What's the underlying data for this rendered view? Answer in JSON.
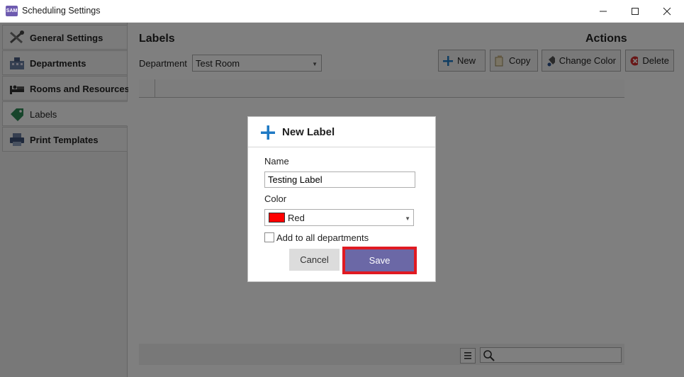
{
  "window": {
    "title": "Scheduling Settings",
    "app_icon_text": "SAM"
  },
  "sidebar": {
    "items": [
      {
        "label": "General Settings",
        "icon": "tools-icon"
      },
      {
        "label": "Departments",
        "icon": "building-icon"
      },
      {
        "label": "Rooms and Resources",
        "icon": "bed-icon"
      },
      {
        "label": "Labels",
        "icon": "tag-icon"
      },
      {
        "label": "Print Templates",
        "icon": "printer-icon"
      }
    ],
    "active": "Labels"
  },
  "main": {
    "labels_title": "Labels",
    "actions_title": "Actions",
    "department_label": "Department",
    "department_value": "Test Room",
    "actions": {
      "new": "New",
      "copy": "Copy",
      "change_color": "Change Color",
      "delete": "Delete"
    }
  },
  "dialog": {
    "title": "New Label",
    "name_label": "Name",
    "name_value": "Testing Label",
    "color_label": "Color",
    "color_value": "Red",
    "color_hex": "#ff0000",
    "add_all_label": "Add to all departments",
    "add_all_checked": false,
    "cancel_label": "Cancel",
    "save_label": "Save"
  },
  "colors": {
    "accent": "#6b68a6",
    "highlight": "#e01a22",
    "plus_blue": "#1f7ac4"
  }
}
